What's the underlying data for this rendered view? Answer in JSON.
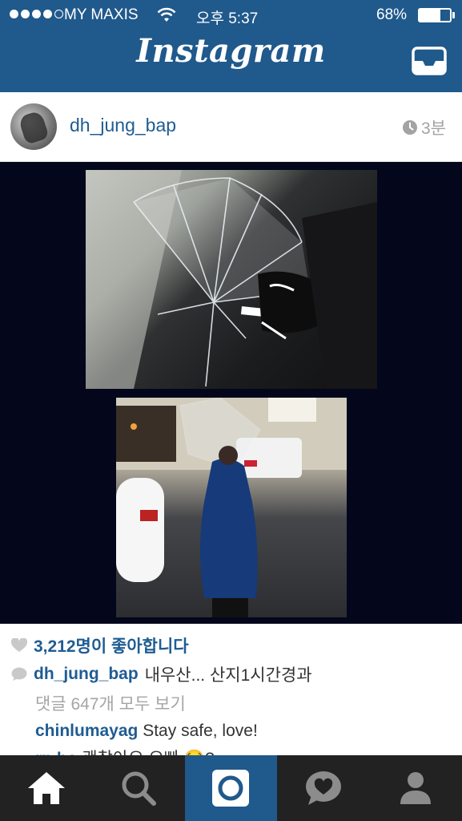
{
  "status_bar": {
    "carrier": "MY MAXIS",
    "time": "오후 5:37",
    "battery_percent": "68%",
    "battery_level": 0.68,
    "signal_bars_filled": 4,
    "signal_bars_total": 5
  },
  "nav": {
    "title": "Instagram",
    "inbox_icon": "inbox-icon"
  },
  "post": {
    "username": "dh_jung_bap",
    "time_ago": "3분",
    "likes": "3,212명이 좋아합니다",
    "caption_user": "dh_jung_bap",
    "caption_text": "내우산... 산지1시간경과",
    "view_all_comments": "댓글 647개 모두 보기",
    "comments": [
      {
        "user": "chinlumayag",
        "text": "Stay safe, love!"
      },
      {
        "user": "rn.bo",
        "text": "괜찮아요 오빠 😂?"
      }
    ]
  },
  "tabbar": {
    "tabs": [
      {
        "name": "home-tab",
        "icon": "home-icon"
      },
      {
        "name": "explore-tab",
        "icon": "search-icon"
      },
      {
        "name": "camera-tab",
        "icon": "camera-icon",
        "active": true
      },
      {
        "name": "activity-tab",
        "icon": "heart-bubble-icon"
      },
      {
        "name": "profile-tab",
        "icon": "profile-icon"
      }
    ]
  },
  "colors": {
    "brand_blue": "#20598c",
    "link_blue": "#1f5c92",
    "tabbar_bg": "#222222",
    "photo_bg": "#04061c"
  }
}
